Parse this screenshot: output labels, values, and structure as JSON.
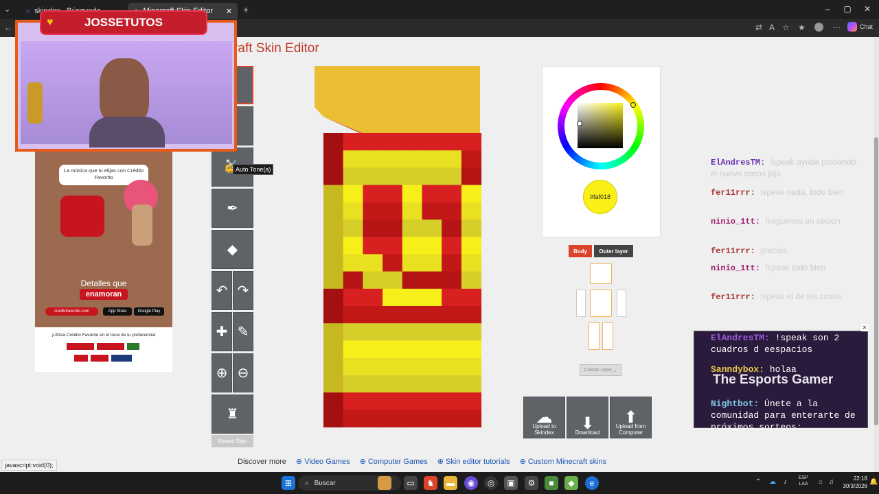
{
  "browser": {
    "tabs": [
      {
        "label": "skindex - Búsqueda"
      },
      {
        "label": "Minecraft Skin Editor"
      }
    ],
    "new_tab": "+",
    "chat_label": "Chat",
    "window_controls": [
      "–",
      "▢",
      "✕"
    ]
  },
  "page": {
    "title": "ecraft Skin Editor",
    "tooltip": "Auto Tone(a)",
    "reset_label": "Reset Skin",
    "tools": [
      {
        "icon": "pencil-icon",
        "glyph": "✎",
        "selected": true
      },
      {
        "icon": "brush-icon",
        "glyph": "✎",
        "selected": false
      },
      {
        "icon": "auto-tone-icon",
        "glyph": "✎",
        "selected": false
      },
      {
        "icon": "eyedropper-icon",
        "glyph": "✒",
        "selected": false
      },
      {
        "icon": "bucket-icon",
        "glyph": "▲",
        "selected": false
      }
    ],
    "color": {
      "hex_label": "#faf018",
      "value": "#faf018"
    },
    "layer_buttons": {
      "body": "Body",
      "outer": "Outer layer"
    },
    "model_select": "Classic (4px)",
    "actions": [
      {
        "label": "Upload to Skindex",
        "icon": "upload-skindex-icon",
        "glyph": "⛨"
      },
      {
        "label": "Download",
        "icon": "download-icon",
        "glyph": "⬇"
      },
      {
        "label": "Upload from Computer",
        "icon": "upload-computer-icon",
        "glyph": "⬆"
      }
    ],
    "discover": "Discover more",
    "links": [
      "Video Games",
      "Computer Games",
      "Skin editor tutorials",
      "Custom Minecraft skins"
    ],
    "status_bar": "javascript:void(0);"
  },
  "stream": {
    "banner": "JOSSETUTOS",
    "chat": [
      {
        "user": "ElAndresTM:",
        "text": "!speak ayuda probando el nuevo cosos jaja",
        "color": "#6a2fb0"
      },
      {
        "user": "fer11rrr:",
        "text": "!speak nada, todo bien",
        "color": "#a33"
      },
      {
        "user": "ninio_1tt:",
        "text": "!seguimos en sesion",
        "color": "#a02070"
      },
      {
        "user": "fer11rrr:",
        "text": "gracias",
        "color": "#a33"
      },
      {
        "user": "ninio_1tt:",
        "text": "!speak todo bien",
        "color": "#a02070"
      },
      {
        "user": "fer11rrr:",
        "text": "!speak el de los cosos",
        "color": "#a33"
      }
    ],
    "overlay": [
      {
        "user": "ElAndresTM:",
        "text": "!speak son 2 cuadros d eespacios",
        "color": "#9b59d9"
      },
      {
        "user": "Sanndybox:",
        "text": "holaa",
        "color": "#e8c84a"
      },
      {
        "user": "Nightbot:",
        "text": "Únete a la comunidad para enterarte de próximos sorteos:",
        "color": "#7ec8e3"
      }
    ],
    "overlay_logo": "The Esports Gamer"
  },
  "ad": {
    "headline": "La música que tu elijas con Crédito Favorito",
    "tagline": "Detalles que",
    "tagline_em": "enamoran",
    "url": "creditofavorito.com",
    "footer": "¡Utiliza Crédito Favorito en el local de tu preferencia!",
    "app_store": "App Store",
    "google_play": "Google Play"
  },
  "taskbar": {
    "search": "Buscar",
    "lang": "ESP",
    "lang2": "LAA",
    "time": "22:18",
    "date": "30/3/2026"
  }
}
